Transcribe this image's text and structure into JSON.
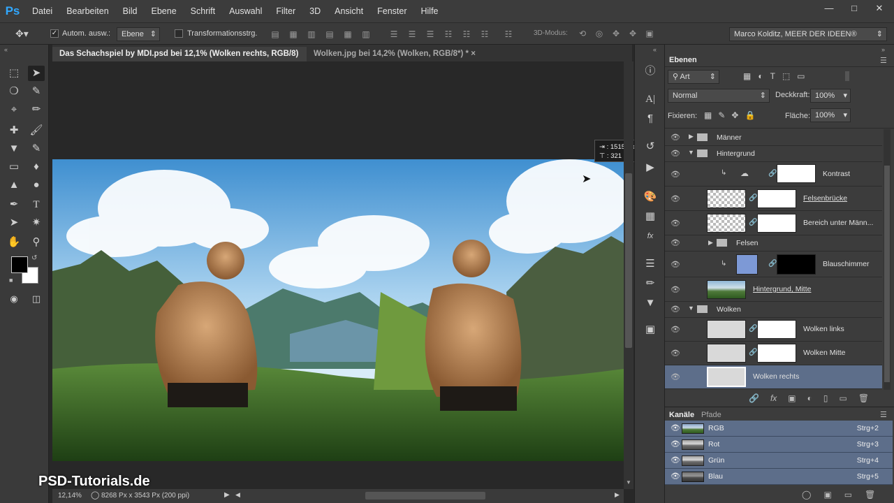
{
  "app": {
    "logo": "Ps"
  },
  "menu": [
    "Datei",
    "Bearbeiten",
    "Bild",
    "Ebene",
    "Schrift",
    "Auswahl",
    "Filter",
    "3D",
    "Ansicht",
    "Fenster",
    "Hilfe"
  ],
  "options": {
    "auto_select_label": "Autom. ausw.:",
    "auto_select_target": "Ebene",
    "transform_label": "Transformationsstrg.",
    "mode3d_label": "3D-Modus:",
    "workspace": "Marco Kolditz, MEER DER IDEEN®"
  },
  "tabs": [
    {
      "label": "Das Schachspiel by MDI.psd bei 12,1% (Wolken rechts, RGB/8) *"
    },
    {
      "label": "Wolken.jpg bei 14,2% (Wolken, RGB/8*) *"
    }
  ],
  "tooltip": {
    "width": "1515 Px",
    "height": "321 Px"
  },
  "watermark": "PSD-Tutorials.de",
  "status": {
    "zoom": "12,14%",
    "doc_info": "8268 Px x 3543 Px (200 ppi)"
  },
  "layers_panel": {
    "title": "Ebenen",
    "filter_kind": "Art",
    "blend_mode": "Normal",
    "opacity_label": "Deckkraft:",
    "opacity": "100%",
    "lock_label": "Fixieren:",
    "fill_label": "Fläche:",
    "fill": "100%",
    "layers": [
      {
        "name": "Männer"
      },
      {
        "name": "Hintergrund"
      },
      {
        "name": "Kontrast"
      },
      {
        "name": "Felsenbrücke"
      },
      {
        "name": "Bereich unter Männ..."
      },
      {
        "name": "Felsen"
      },
      {
        "name": "Blauschimmer"
      },
      {
        "name": "Hintergrund, Mitte"
      },
      {
        "name": "Wolken"
      },
      {
        "name": "Wolken links"
      },
      {
        "name": "Wolken Mitte"
      },
      {
        "name": "Wolken rechts"
      }
    ]
  },
  "channels_panel": {
    "tab_channels": "Kanäle",
    "tab_paths": "Pfade",
    "channels": [
      {
        "name": "RGB",
        "shortcut": "Strg+2"
      },
      {
        "name": "Rot",
        "shortcut": "Strg+3"
      },
      {
        "name": "Grün",
        "shortcut": "Strg+4"
      },
      {
        "name": "Blau",
        "shortcut": "Strg+5"
      }
    ]
  },
  "colors": {
    "accent": "#31a8ff",
    "selection": "#5d6e8a"
  }
}
